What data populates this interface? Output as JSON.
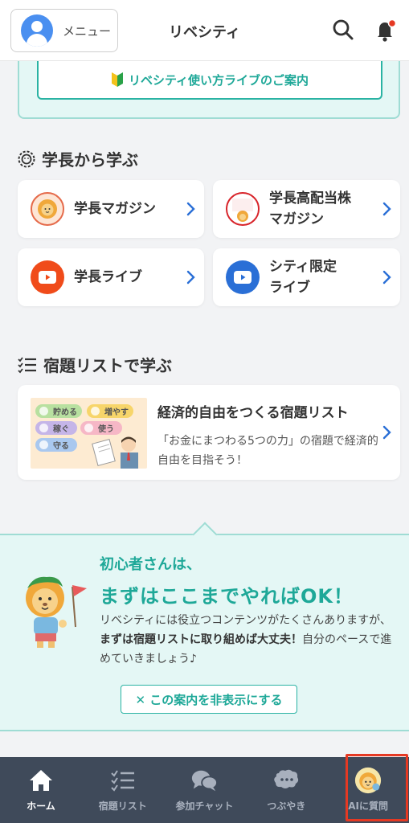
{
  "header": {
    "menu_label": "メニュー",
    "title": "リベシティ",
    "notification_dot": true
  },
  "guide": {
    "live_guide_label": "リベシティ使い方ライブのご案内"
  },
  "president_section": {
    "title": "学長から学ぶ",
    "tiles": [
      {
        "label": "学長マガジン",
        "icon": "lion-magazine-icon"
      },
      {
        "label_line1": "学長高配当株",
        "label_line2": "マガジン",
        "icon": "dividend-stock-icon",
        "icon_text": "学長\n高配当株"
      },
      {
        "label": "学長ライブ",
        "icon": "youtube-red-icon"
      },
      {
        "label_line1": "シティ限定",
        "label_line2": "ライブ",
        "icon": "youtube-blue-icon"
      }
    ]
  },
  "homework_section": {
    "title": "宿題リストで学ぶ",
    "card_title": "経済的自由をつくる宿題リスト",
    "card_desc": "「お金にまつわる5つの力」の宿題で経済的自由を目指そう！",
    "image_pills": [
      "貯める",
      "増やす",
      "稼ぐ",
      "使う",
      "守る"
    ]
  },
  "beginner_panel": {
    "line1": "初心者さんは、",
    "line2": "まずはここまでやればOK！",
    "body_pre": "リベシティには役立つコンテンツがたくさんありますが、",
    "body_bold": "まずは宿題リストに取り組めば大丈夫！",
    "body_post": "自分のペースで進めていきましょう♪",
    "hide_button": "✕ この案内を非表示にする"
  },
  "bottom_nav": {
    "items": [
      {
        "label": "ホーム",
        "icon": "home-icon",
        "active": true
      },
      {
        "label": "宿題リスト",
        "icon": "checklist-icon",
        "active": false
      },
      {
        "label": "参加チャット",
        "icon": "chat-bubbles-icon",
        "active": false
      },
      {
        "label": "つぶやき",
        "icon": "tweet-bubble-icon",
        "active": false
      },
      {
        "label": "AIに質問",
        "icon": "ai-lion-avatar-icon",
        "active": false
      }
    ]
  },
  "colors": {
    "accent_teal": "#1ea898",
    "panel_bg": "#e4f7f5",
    "nav_bg": "#3f4a5a",
    "chevron_blue": "#2a6fd6",
    "youtube_red": "#f04b1a",
    "youtube_blue": "#2a6fd6",
    "highlight_red": "#e53923"
  }
}
